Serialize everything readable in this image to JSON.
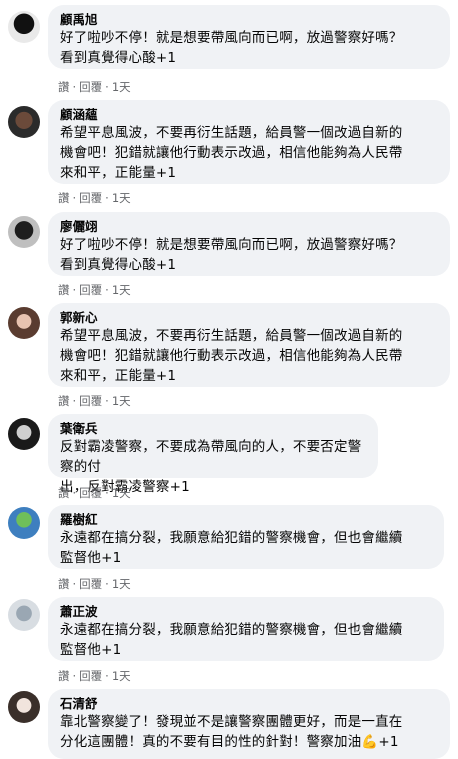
{
  "comments": [
    {
      "author": "顧禹旭",
      "text": "好了啦吵不停！就是想要帶風向而已啊，放過警察好嗎？\n看到真覺得心酸+1",
      "like": "讚",
      "reply": "回覆",
      "time": "1天",
      "emoji": ""
    },
    {
      "author": "顧涵蘊",
      "text": "希望平息風波，不要再衍生話題，給員警一個改過自新的\n機會吧！犯錯就讓他行動表示改過，相信他能夠為人民帶\n來和平，正能量+1",
      "like": "讚",
      "reply": "回覆",
      "time": "1天",
      "emoji": ""
    },
    {
      "author": "廖儷翊",
      "text": "好了啦吵不停！就是想要帶風向而已啊，放過警察好嗎？\n看到真覺得心酸+1",
      "like": "讚",
      "reply": "回覆",
      "time": "1天",
      "emoji": ""
    },
    {
      "author": "郭新心",
      "text": "希望平息風波，不要再衍生話題，給員警一個改過自新的\n機會吧！犯錯就讓他行動表示改過，相信他能夠為人民帶\n來和平，正能量+1",
      "like": "讚",
      "reply": "回覆",
      "time": "1天",
      "emoji": ""
    },
    {
      "author": "葉衛兵",
      "text": "反對霸凌警察，不要成為帶風向的人，不要否定警察的付\n出，反對霸凌警察+1",
      "like": "讚",
      "reply": "回覆",
      "time": "1天",
      "emoji": ""
    },
    {
      "author": "羅樹紅",
      "text": "永遠都在搞分裂，我願意給犯錯的警察機會，但也會繼續\n監督他+1",
      "like": "讚",
      "reply": "回覆",
      "time": "1天",
      "emoji": ""
    },
    {
      "author": "蕭正波",
      "text": "永遠都在搞分裂，我願意給犯錯的警察機會，但也會繼續\n監督他+1",
      "like": "讚",
      "reply": "回覆",
      "time": "1天",
      "emoji": ""
    },
    {
      "author": "石清舒",
      "text": "靠北警察變了！發現並不是讓警察團體更好，而是一直在\n分化這團體！真的不要有目的性的針對！警察加油",
      "like": "讚",
      "reply": "回覆",
      "time": "1天",
      "emoji": "💪+1"
    }
  ],
  "colors": {
    "bubble": "#f0f2f5",
    "meta": "#65676b",
    "text": "#050505"
  }
}
